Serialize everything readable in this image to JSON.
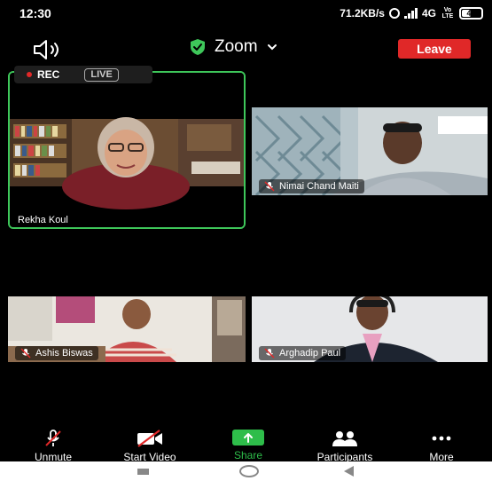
{
  "status_bar": {
    "time": "12:30",
    "network_speed": "71.2KB/s",
    "network_type": "4G",
    "volte": "Vo LTE",
    "battery": "47",
    "battery_level": 0.47
  },
  "header": {
    "app_title": "Zoom",
    "leave_label": "Leave",
    "leave_color": "#e02828",
    "security_color": "#3ec75a"
  },
  "recording": {
    "rec_label": "REC",
    "live_label": "LIVE"
  },
  "participants": [
    {
      "name": "Rekha Koul",
      "muted": false,
      "active_speaker": true
    },
    {
      "name": "Nimai Chand Maiti",
      "muted": true,
      "active_speaker": false
    },
    {
      "name": "Ashis Biswas",
      "muted": true,
      "active_speaker": false
    },
    {
      "name": "Arghadip Paul",
      "muted": true,
      "active_speaker": false
    }
  ],
  "toolbar": {
    "unmute": "Unmute",
    "start_video": "Start Video",
    "share": "Share",
    "participants": "Participants",
    "more": "More",
    "share_color": "#2ebd4a"
  },
  "icons": {
    "speaker": "speaker-icon",
    "shield": "shield-check-icon",
    "mic_off": "mic-off-icon",
    "video_off": "video-off-icon",
    "share": "share-arrow-icon",
    "participants": "people-icon",
    "more": "more-dots-icon"
  }
}
